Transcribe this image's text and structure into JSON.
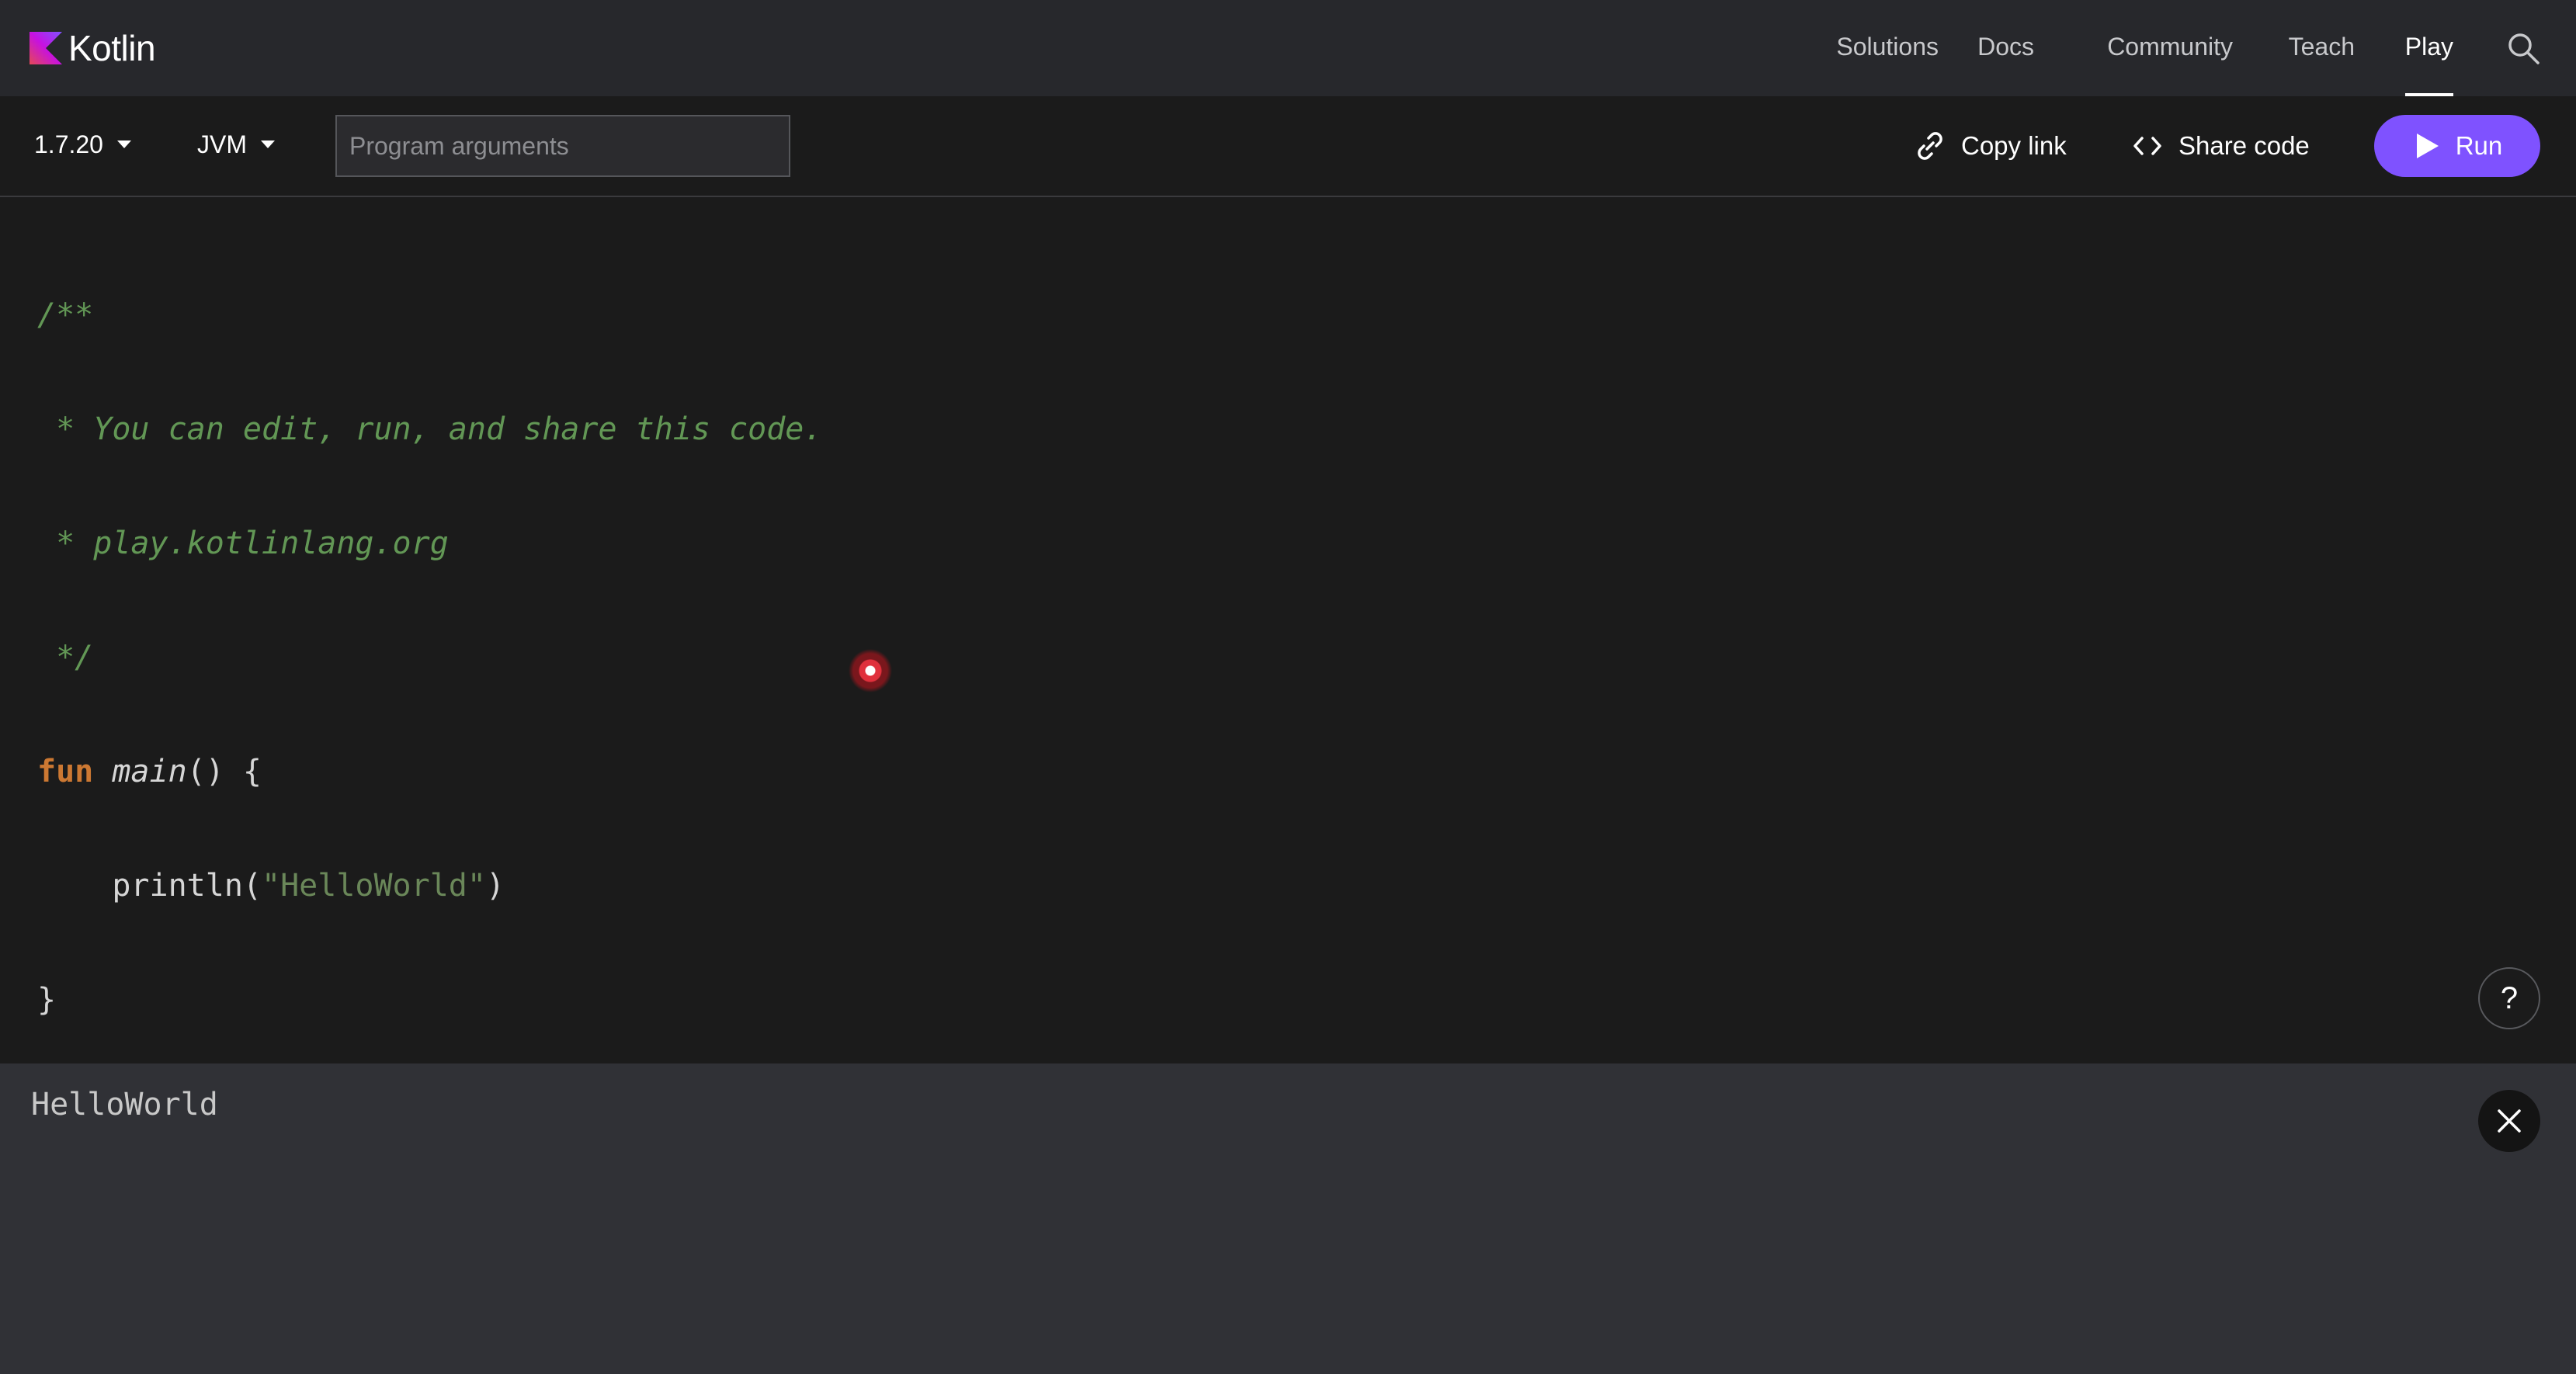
{
  "brand": {
    "name": "Kotlin"
  },
  "nav": {
    "items": [
      {
        "label": "Solutions",
        "active": false
      },
      {
        "label": "Docs",
        "active": false
      },
      {
        "label": "Community",
        "active": false
      },
      {
        "label": "Teach",
        "active": false
      },
      {
        "label": "Play",
        "active": true
      }
    ],
    "search_icon": "search-icon"
  },
  "toolbar": {
    "version": "1.7.20",
    "target": "JVM",
    "args_placeholder": "Program arguments",
    "args_value": "",
    "copy_link_label": "Copy link",
    "share_code_label": "Share code",
    "run_label": "Run"
  },
  "editor": {
    "lines": {
      "l1": "/**",
      "l2": " * You can edit, run, and share this code.",
      "l3": " * play.kotlinlang.org",
      "l4": " */",
      "l5_kw": "fun",
      "l5_fn": "main",
      "l5_rest": "() {",
      "l6_pre": "    println(",
      "l6_str": "\"HelloWorld\"",
      "l6_post": ")",
      "l7": "}"
    },
    "help_label": "?"
  },
  "output": {
    "text": "HelloWorld"
  },
  "colors": {
    "accent": "#7f52ff",
    "nav_bg": "#27282c",
    "editor_bg": "#1b1b1b",
    "output_bg": "#303136",
    "comment": "#629755",
    "keyword": "#cc7832",
    "string": "#6a8759"
  }
}
